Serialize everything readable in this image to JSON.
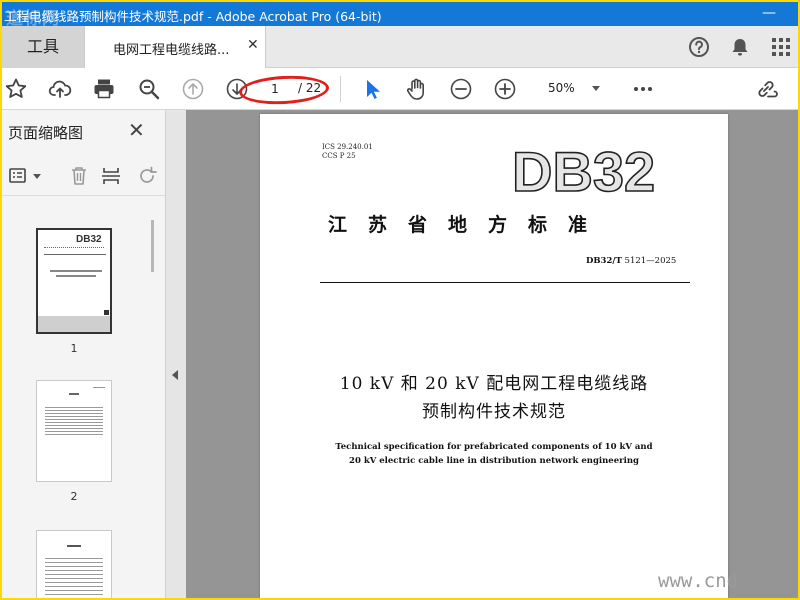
{
  "window": {
    "title": "工程电缆线路预制构件技术规范.pdf - Adobe Acrobat Pro (64-bit)",
    "watermark_logo": "道标网"
  },
  "tabs": {
    "tools_label": "工具",
    "doc_label": "电网工程电缆线路..."
  },
  "toolbar": {
    "page_current": "1",
    "page_total": "/ 22",
    "zoom": "50%"
  },
  "sidebar": {
    "title": "页面缩略图",
    "thumbnails": [
      {
        "label": "1"
      },
      {
        "label": "2"
      }
    ]
  },
  "document": {
    "ics": "ICS 29.240.01",
    "ccs": "CCS P 25",
    "logo": "DB32",
    "standard_name": "江苏省地方标准",
    "code_prefix": "DB32/T",
    "code_number": "5121—2025",
    "title_cn_line1": "10 kV 和 20 kV 配电网工程电缆线路",
    "title_cn_line2": "预制构件技术规范",
    "title_en_line1": "Technical specification for prefabricated components of 10 kV and",
    "title_en_line2": "20 kV electric cable line in distribution network engineering"
  },
  "watermark": "www.cnd",
  "colors": {
    "titlebar": "#1479d6",
    "frame": "#ffd800",
    "highlight": "#e0201a",
    "selection": "#1a73e8"
  }
}
